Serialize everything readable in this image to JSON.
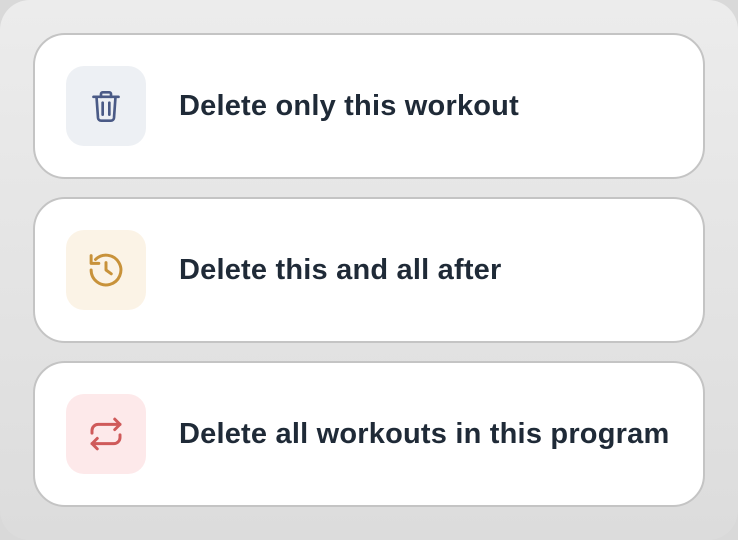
{
  "options": [
    {
      "label": "Delete only this workout",
      "icon": "trash-icon",
      "icon_color": "#4a5a86",
      "tile_color": "#edf0f4"
    },
    {
      "label": "Delete this and all after",
      "icon": "history-icon",
      "icon_color": "#c8923a",
      "tile_color": "#fbf3e6"
    },
    {
      "label": "Delete all workouts in this program",
      "icon": "repeat-icon",
      "icon_color": "#cf5a5a",
      "tile_color": "#fde9ea"
    }
  ]
}
